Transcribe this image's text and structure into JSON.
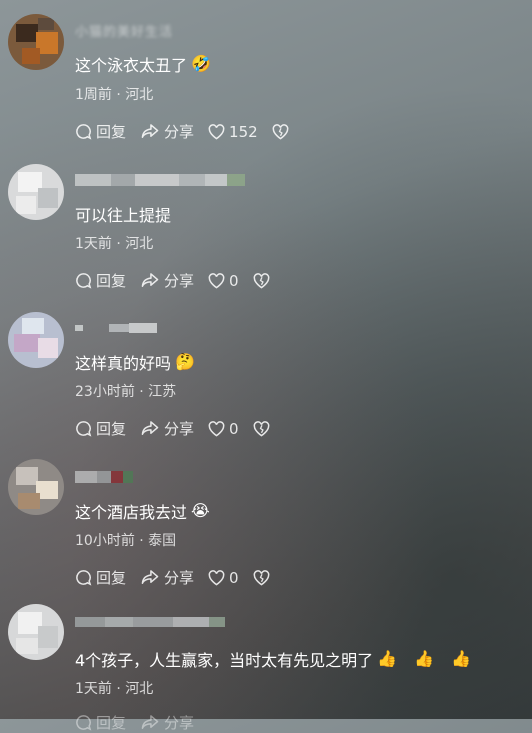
{
  "comments": [
    {
      "username": "小猫的美好生活",
      "text": "这个泳衣太丑了",
      "emoji": "🤣",
      "meta": "1周前 · 河北",
      "reply": "回复",
      "share": "分享",
      "likes": "152"
    },
    {
      "username": "",
      "text": "可以往上提提",
      "emoji": "",
      "meta": "1天前 · 河北",
      "reply": "回复",
      "share": "分享",
      "likes": "0"
    },
    {
      "username": "",
      "text": "这样真的好吗",
      "emoji": "🤔",
      "meta": "23小时前 · 江苏",
      "reply": "回复",
      "share": "分享",
      "likes": "0"
    },
    {
      "username": "",
      "text": "这个酒店我去过",
      "emoji": "😭",
      "meta": "10小时前 · 泰国",
      "reply": "回复",
      "share": "分享",
      "likes": "0"
    },
    {
      "username": "",
      "text": "4个孩子，人生赢家，当时太有先见之明了",
      "emoji": "👍 👍 👍",
      "meta": "1天前 · 河北",
      "reply": "回复",
      "share": "分享",
      "likes": ""
    }
  ],
  "colors": {
    "text": "#ffffff",
    "meta": "rgba(255,255,255,0.78)"
  }
}
